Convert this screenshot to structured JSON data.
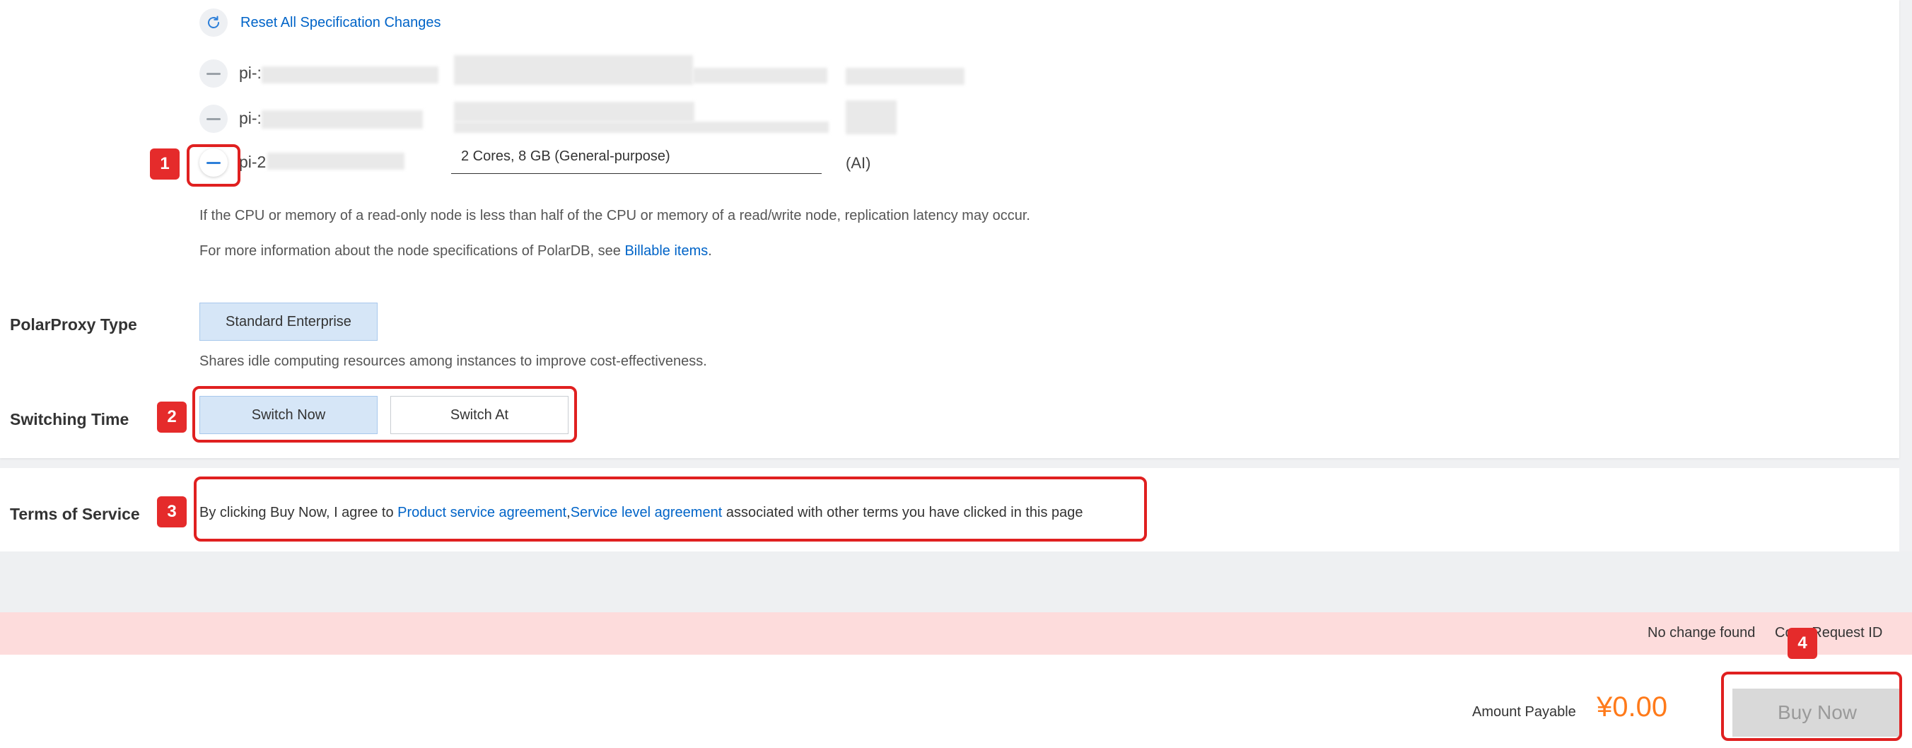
{
  "spec": {
    "reset_label": "Reset All Specification Changes",
    "nodes": [
      {
        "name": "pi-:",
        "spec": "",
        "type": ""
      },
      {
        "name": "pi-:",
        "spec": "",
        "type": ""
      },
      {
        "name": "pi-2",
        "spec": "2 Cores, 8 GB (General-purpose)",
        "type": "(AI)"
      }
    ],
    "note_latency": "If the CPU or memory of a read-only node is less than half of the CPU or memory of a read/write node, replication latency may occur.",
    "note_more_prefix": "For more information about the node specifications of PolarDB, see ",
    "note_more_link": "Billable items",
    "note_more_suffix": "."
  },
  "proxy": {
    "label": "PolarProxy Type",
    "option": "Standard Enterprise",
    "description": "Shares idle computing resources among instances to improve cost-effectiveness."
  },
  "switching": {
    "label": "Switching Time",
    "options": [
      "Switch Now",
      "Switch At"
    ],
    "selected": "Switch Now"
  },
  "tos": {
    "label": "Terms of Service",
    "prefix": "By clicking Buy Now, I agree to ",
    "link1": "Product service agreement",
    "separator": ",",
    "link2": "Service level agreement",
    "suffix": " associated with other terms you have clicked in this page"
  },
  "status": {
    "message": "No change found",
    "request_id_link": "Copy Request ID"
  },
  "footer": {
    "amount_label": "Amount Payable",
    "amount_value": "¥0.00",
    "buy_label": "Buy Now"
  },
  "annotations": [
    "1",
    "2",
    "3",
    "4"
  ],
  "colors": {
    "link": "#0064c8",
    "price": "#ff7a1a",
    "annotation": "#e02020",
    "selected_option": "#d6e6f7",
    "status_band": "#fddcdc"
  }
}
